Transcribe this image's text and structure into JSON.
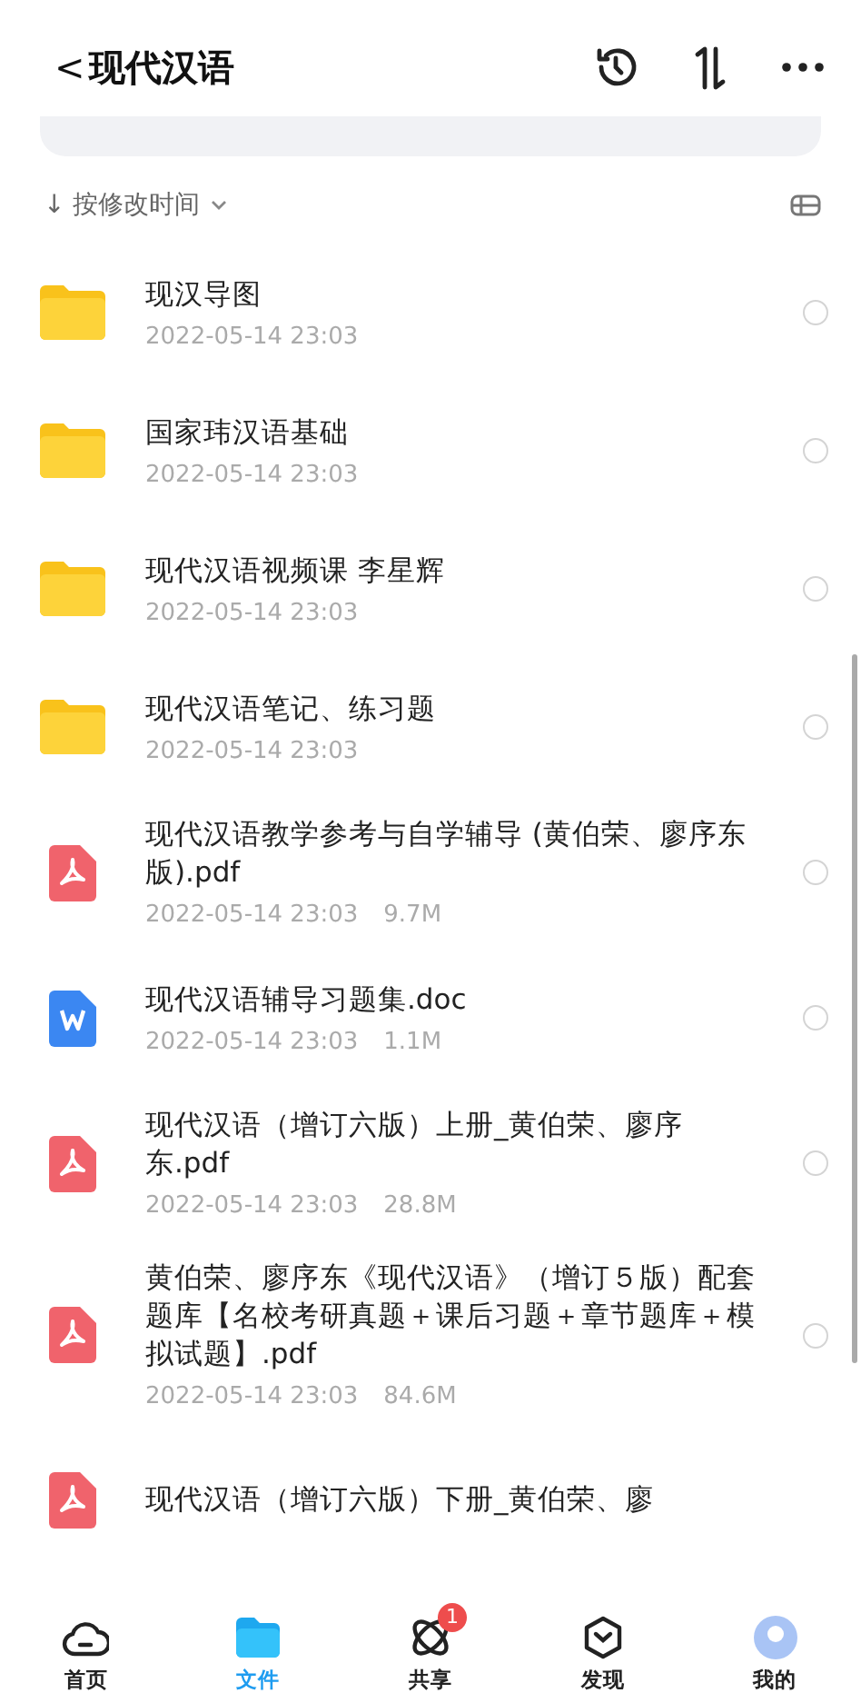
{
  "header": {
    "back": "<",
    "title": "现代汉语"
  },
  "sort": {
    "arrow": "↓",
    "label": "按修改时间"
  },
  "files": [
    {
      "kind": "folder",
      "name": "现汉导图",
      "date": "2022-05-14 23:03",
      "selected": false
    },
    {
      "kind": "folder",
      "name": "国家玮汉语基础",
      "date": "2022-05-14 23:03",
      "selected": false
    },
    {
      "kind": "folder",
      "name": "现代汉语视频课 李星辉",
      "date": "2022-05-14 23:03",
      "selected": false
    },
    {
      "kind": "folder",
      "name": "现代汉语笔记、练习题",
      "date": "2022-05-14 23:03",
      "selected": false
    },
    {
      "kind": "pdf",
      "name": "现代汉语教学参考与自学辅导 (黄伯荣、廖序东版).pdf",
      "date": "2022-05-14 23:03",
      "size": "9.7M",
      "selected": false
    },
    {
      "kind": "doc",
      "name": "现代汉语辅导习题集.doc",
      "date": "2022-05-14 23:03",
      "size": "1.1M",
      "selected": false
    },
    {
      "kind": "pdf",
      "name": "现代汉语（增订六版）上册_黄伯荣、廖序东.pdf",
      "date": "2022-05-14 23:03",
      "size": "28.8M",
      "selected": false
    },
    {
      "kind": "pdf",
      "name": "黄伯荣、廖序东《现代汉语》（增订５版）配套题库【名校考研真题＋课后习题＋章节题库＋模拟试题】.pdf",
      "date": "2022-05-14 23:03",
      "size": "84.6M",
      "selected": false
    },
    {
      "kind": "pdf",
      "name": "现代汉语（增订六版）下册_黄伯荣、廖"
    }
  ],
  "tabs": [
    {
      "kind": "home",
      "label": "首页",
      "selected": false
    },
    {
      "kind": "files",
      "label": "文件",
      "selected": true
    },
    {
      "kind": "share",
      "label": "共享",
      "selected": false,
      "badge": "1"
    },
    {
      "kind": "discover",
      "label": "发现",
      "selected": false
    },
    {
      "kind": "me",
      "label": "我的",
      "selected": false
    }
  ]
}
